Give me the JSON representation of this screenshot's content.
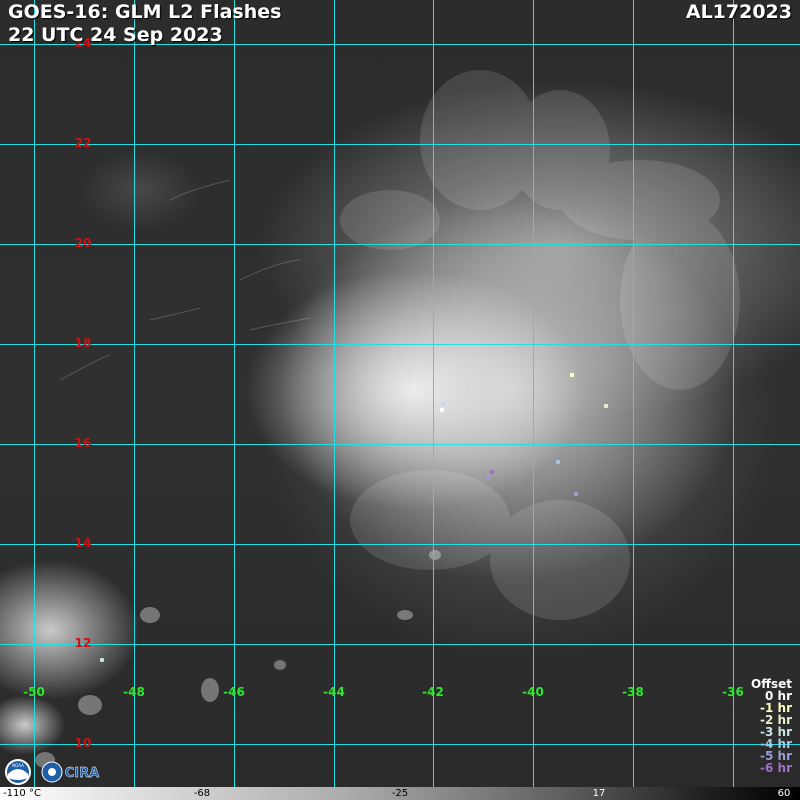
{
  "header": {
    "title_line1": "GOES-16: GLM L2 Flashes",
    "title_line2": "22 UTC 24 Sep 2023",
    "storm_id": "AL172023"
  },
  "map": {
    "latitudes": [
      {
        "value": "24"
      },
      {
        "value": "22"
      },
      {
        "value": "20"
      },
      {
        "value": "18"
      },
      {
        "value": "16"
      },
      {
        "value": "14"
      },
      {
        "value": "12"
      },
      {
        "value": "10"
      }
    ],
    "longitudes": [
      {
        "value": "-50"
      },
      {
        "value": "-48"
      },
      {
        "value": "-46"
      },
      {
        "value": "-44"
      },
      {
        "value": "-42"
      },
      {
        "value": "-40"
      },
      {
        "value": "-38"
      },
      {
        "value": "-36"
      }
    ],
    "gridline_color": "#22e0e0",
    "lat_label_color": "#d01010",
    "lon_label_color": "#2ee62e"
  },
  "legend": {
    "title": "Offset",
    "items": [
      {
        "label": "0 hr",
        "color": "#ffffff"
      },
      {
        "label": "-1 hr",
        "color": "#ffffc0"
      },
      {
        "label": "-2 hr",
        "color": "#e8f2d0"
      },
      {
        "label": "-3 hr",
        "color": "#c8e4e4"
      },
      {
        "label": "-4 hr",
        "color": "#a8c8e8"
      },
      {
        "label": "-5 hr",
        "color": "#9c9cd8"
      },
      {
        "label": "-6 hr",
        "color": "#a070c8"
      }
    ]
  },
  "colorbar": {
    "labels": [
      "-110 °C",
      "-68",
      "-25",
      "17",
      "60"
    ]
  },
  "logos": {
    "noaa_text": "NOAA",
    "cira_text": "CIRA"
  }
}
